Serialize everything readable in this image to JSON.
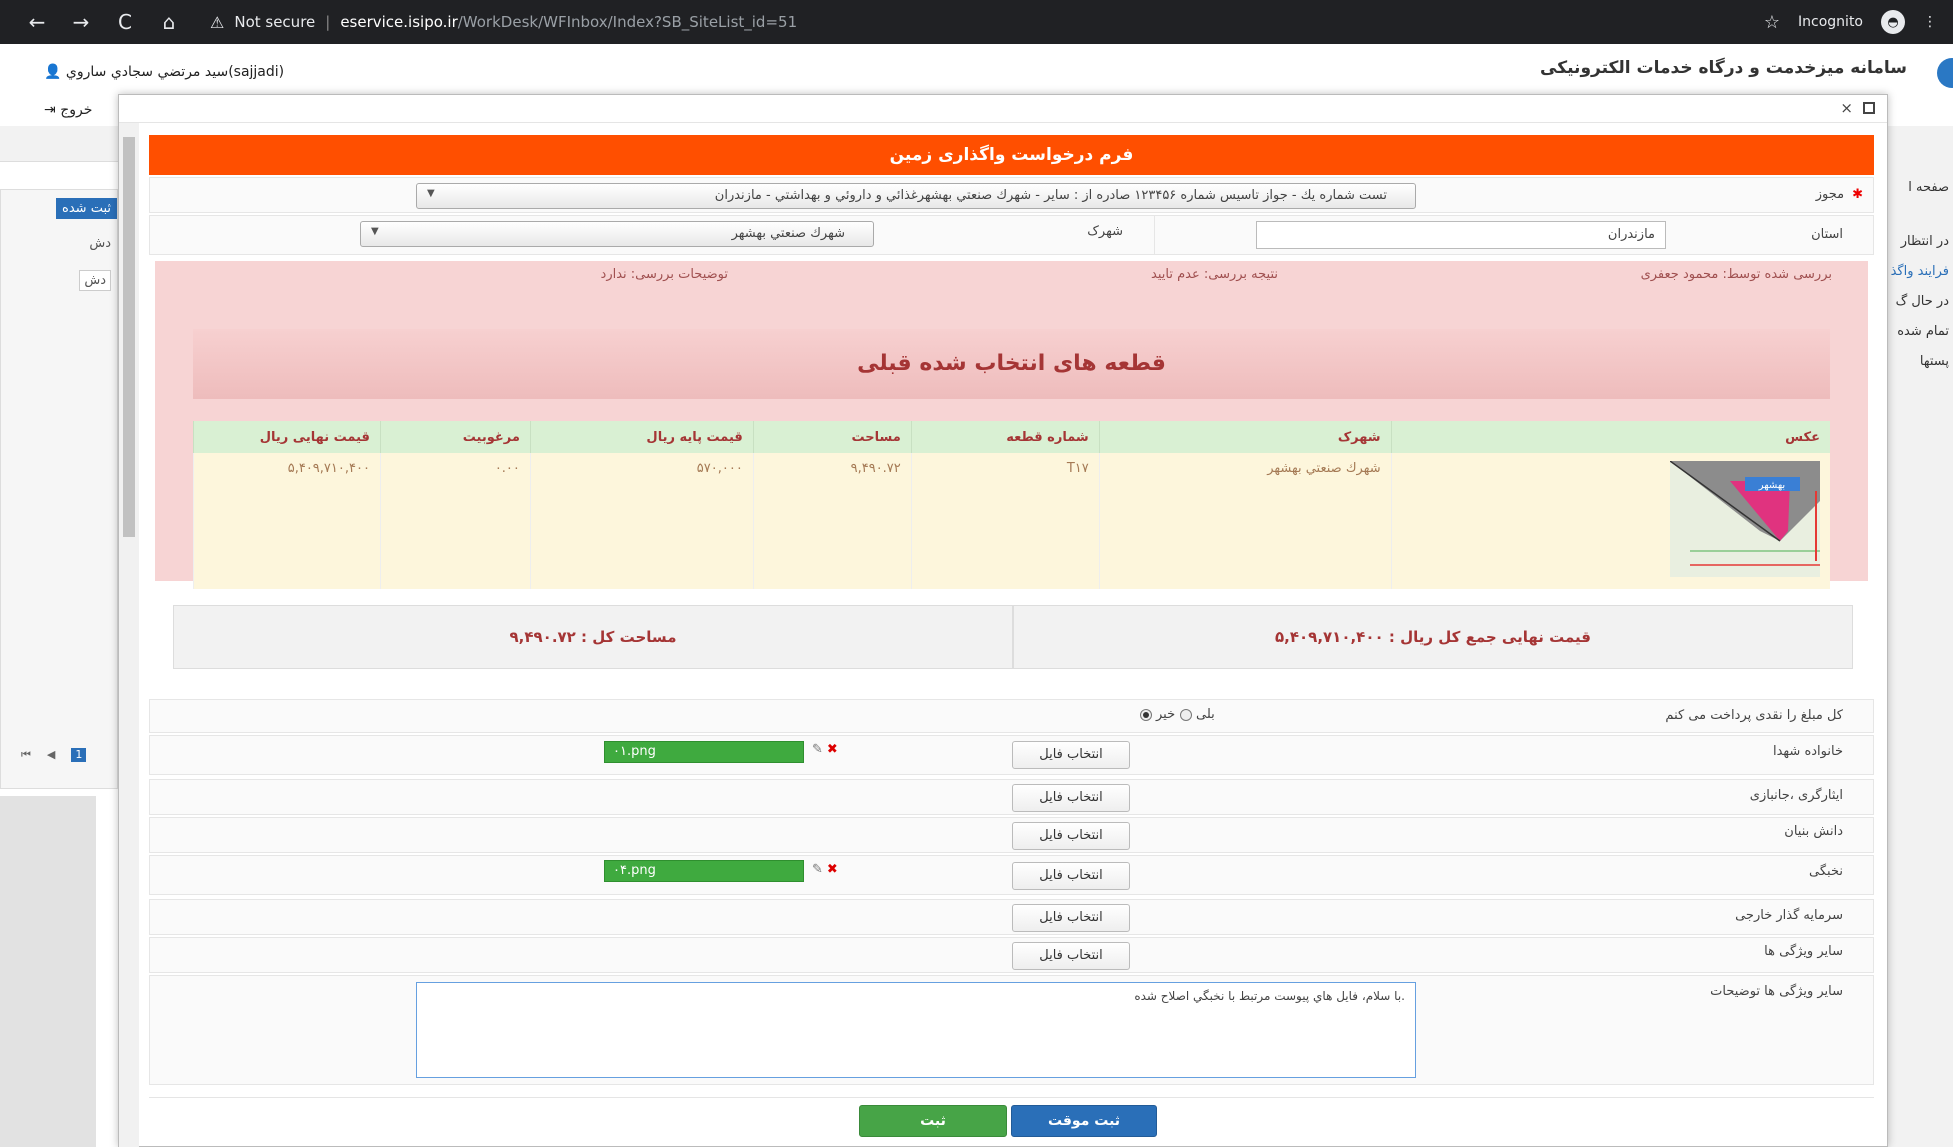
{
  "browser": {
    "back": "←",
    "forward": "→",
    "reload": "C",
    "home": "⌂",
    "security": "Not secure",
    "url_host": "eservice.isipo.ir",
    "url_path": "/WorkDesk/WFInbox/Index?SB_SiteList_id=51",
    "incognito": "Incognito"
  },
  "background": {
    "user": "سيد مرتضي سجادي ساروي(sajjadi)",
    "logout": "خروج",
    "app_title": "سامانه میزخدمت و درگاه خدمات الکترونیکی",
    "registered_badge": "ثبت شده",
    "cell1": "دش",
    "cell2": "دش",
    "side_home": "صفحه ا",
    "side_waiting": "در انتظار",
    "side_process": "فرایند واگذ",
    "side_inprogress": "در حال گ",
    "side_done": "تمام شده",
    "side_posts": "پستها"
  },
  "form": {
    "title": "فرم درخواست واگذاری زمین",
    "permit_label": "مجوز",
    "permit_value": "تست شماره يك - جواز تاسيس شماره ۱۲۳۴۵۶ صادره از : ساير - شهرك صنعتي بهشهرغذائي و داروئي و بهداشتي - مازندران",
    "province_label": "استان",
    "province_value": "مازندران",
    "town_label": "شهرک",
    "town_value": "شهرك صنعتي بهشهر",
    "review": {
      "reviewed_by": "بررسی شده توسط: محمود جعفری",
      "result": "نتیجه بررسی: عدم تایید",
      "notes": "توضیحات بررسی: ندارد"
    },
    "plots_title": "قطعه های انتخاب شده قبلی",
    "table": {
      "headers": [
        "عکس",
        "شهرک",
        "شماره قطعه",
        "مساحت",
        "قیمت پایه ریال",
        "مرغوبیت",
        "قیمت نهایی ریال"
      ],
      "row": {
        "town": "شهرك صنعتي بهشهر",
        "plot_no": "T۱۷",
        "area": "۹,۴۹۰.۷۲",
        "base_price": "۵۷۰,۰۰۰",
        "quality": "۰.۰۰",
        "final_price": "۵,۴۰۹,۷۱۰,۴۰۰",
        "map_label": "بهشهر"
      }
    },
    "total_price": "قیمت نهایی جمع کل ریال : ۵,۴۰۹,۷۱۰,۴۰۰",
    "total_area": "مساحت کل : ۹,۴۹۰.۷۲",
    "cash_label": "کل مبلغ را نقدی پرداخت می کنم",
    "cash_yes": "بلی",
    "cash_no": "خیر",
    "file_button": "انتخاب فایل",
    "files": [
      {
        "label": "خانواده شهدا",
        "file": "۰۱.png"
      },
      {
        "label": "ایثارگری ،جانبازی",
        "file": ""
      },
      {
        "label": "دانش بنیان",
        "file": ""
      },
      {
        "label": "نخبگی",
        "file": "۰۴.png"
      },
      {
        "label": "سرمایه گذار خارجی",
        "file": ""
      },
      {
        "label": "سایر ویژگی ها",
        "file": ""
      }
    ],
    "notes_label": "سایر ویژگی ها توضیحات",
    "notes_value": "با سلام، فايل هاي پيوست مرتبط با نخبگي اصلاح شده.",
    "save_temp": "ثبت موقت",
    "submit": "ثبت"
  }
}
